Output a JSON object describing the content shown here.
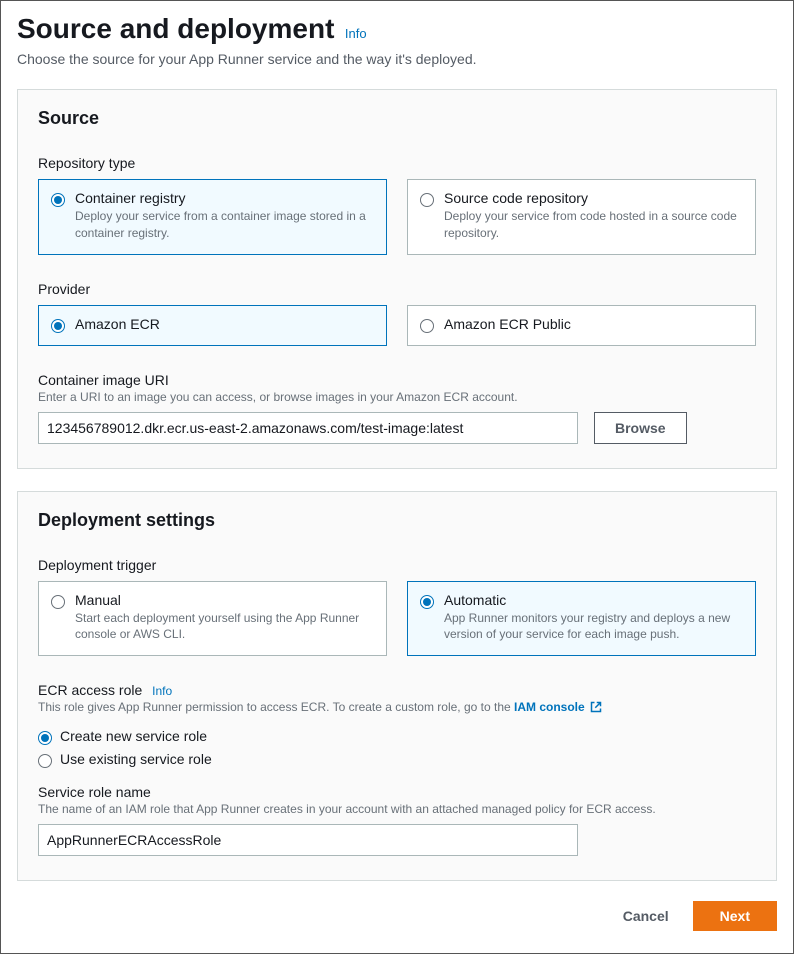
{
  "header": {
    "title": "Source and deployment",
    "info": "Info",
    "subtitle": "Choose the source for your App Runner service and the way it's deployed."
  },
  "source": {
    "title": "Source",
    "repoType": {
      "label": "Repository type",
      "options": [
        {
          "title": "Container registry",
          "desc": "Deploy your service from a container image stored in a container registry."
        },
        {
          "title": "Source code repository",
          "desc": "Deploy your service from code hosted in a source code repository."
        }
      ]
    },
    "provider": {
      "label": "Provider",
      "options": [
        {
          "title": "Amazon ECR"
        },
        {
          "title": "Amazon ECR Public"
        }
      ]
    },
    "imageUri": {
      "label": "Container image URI",
      "help": "Enter a URI to an image you can access, or browse images in your Amazon ECR account.",
      "value": "123456789012.dkr.ecr.us-east-2.amazonaws.com/test-image:latest",
      "browse": "Browse"
    }
  },
  "deployment": {
    "title": "Deployment settings",
    "trigger": {
      "label": "Deployment trigger",
      "options": [
        {
          "title": "Manual",
          "desc": "Start each deployment yourself using the App Runner console or AWS CLI."
        },
        {
          "title": "Automatic",
          "desc": "App Runner monitors your registry and deploys a new version of your service for each image push."
        }
      ]
    },
    "ecrRole": {
      "label": "ECR access role",
      "info": "Info",
      "help": "This role gives App Runner permission to access ECR. To create a custom role, go to the ",
      "iamLink": "IAM console",
      "options": [
        {
          "label": "Create new service role"
        },
        {
          "label": "Use existing service role"
        }
      ]
    },
    "roleName": {
      "label": "Service role name",
      "help": "The name of an IAM role that App Runner creates in your account with an attached managed policy for ECR access.",
      "value": "AppRunnerECRAccessRole"
    }
  },
  "footer": {
    "cancel": "Cancel",
    "next": "Next"
  }
}
